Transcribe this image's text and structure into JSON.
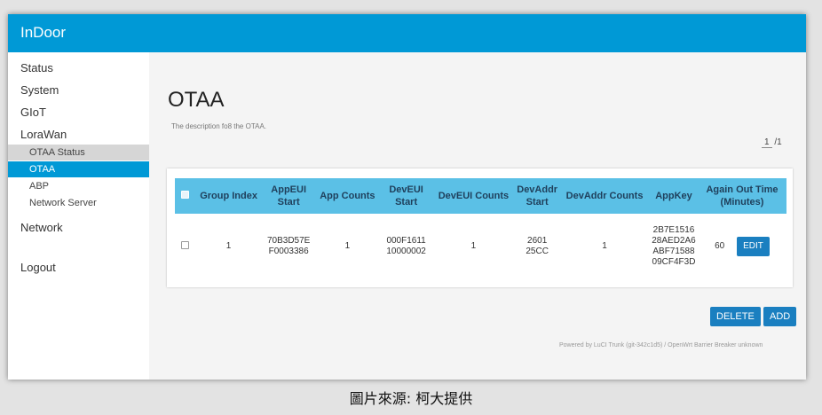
{
  "app": {
    "brand": "InDoor"
  },
  "sidebar": {
    "items": [
      {
        "label": "Status"
      },
      {
        "label": "System"
      },
      {
        "label": "GIoT"
      },
      {
        "label": "LoraWan"
      }
    ],
    "subitems": [
      {
        "label": "OTAA Status"
      },
      {
        "label": "OTAA"
      },
      {
        "label": "ABP"
      },
      {
        "label": "Network Server"
      }
    ],
    "network": "Network",
    "logout": "Logout"
  },
  "page": {
    "title": "OTAA",
    "description": "The description fo8 the OTAA.",
    "pager": {
      "current": "1",
      "total": "/1"
    }
  },
  "table": {
    "headers": [
      "Group Index",
      "AppEUI Start",
      "App Counts",
      "DevEUI Start",
      "DevEUI Counts",
      "DevAddr Start",
      "DevAddr Counts",
      "AppKey",
      "Again Out Time (Minutes)"
    ],
    "row": {
      "group_index": "1",
      "appeui_start": "70B3D57E F0003386",
      "app_counts": "1",
      "deveui_start": "000F1611 10000002",
      "deveui_counts": "1",
      "devaddr_start": "2601 25CC",
      "devaddr_counts": "1",
      "appkey": "2B7E1516 28AED2A6 ABF71588 09CF4F3D",
      "again_out_time": "60",
      "edit_label": "EDIT"
    }
  },
  "actions": {
    "delete": "DELETE",
    "add": "ADD"
  },
  "footer": {
    "powered": "Powered by LuCI Trunk (git-342c1d5) / OpenWrt Barrier Breaker unknown"
  },
  "caption": "圖片來源: 柯大提供",
  "colors": {
    "accent": "#0099d6",
    "table_header": "#5bc0e6",
    "button": "#1a7fc0"
  }
}
